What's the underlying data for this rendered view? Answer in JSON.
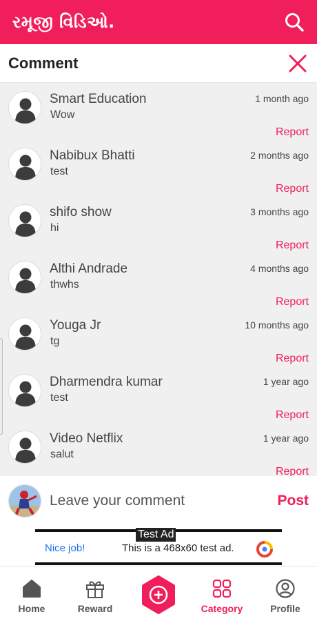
{
  "app": {
    "title": "રમૂજી વિડિઓ."
  },
  "sheet": {
    "title": "Comment"
  },
  "comments": [
    {
      "name": "Smart Education",
      "time": "1 month ago",
      "text": "Wow",
      "report": "Report"
    },
    {
      "name": "Nabibux Bhatti",
      "time": "2 months ago",
      "text": "test",
      "report": "Report"
    },
    {
      "name": "shifo show",
      "time": "3 months ago",
      "text": "hi",
      "report": "Report"
    },
    {
      "name": "Althi Andrade",
      "time": "4 months ago",
      "text": "thwhs",
      "report": "Report"
    },
    {
      "name": "Youga Jr",
      "time": "10 months ago",
      "text": "tg",
      "report": "Report"
    },
    {
      "name": "Dharmendra kumar",
      "time": "1 year ago",
      "text": "test",
      "report": "Report"
    },
    {
      "name": "Video Netflix",
      "time": "1 year ago",
      "text": "salut",
      "report": "Report"
    }
  ],
  "composer": {
    "placeholder": "Leave your comment",
    "post_label": "Post"
  },
  "ad": {
    "label": "Test Ad",
    "cta": "Nice job!",
    "text": "This is a 468x60 test ad."
  },
  "nav": {
    "home": "Home",
    "reward": "Reward",
    "category": "Category",
    "profile": "Profile",
    "active": "category"
  },
  "colors": {
    "accent": "#f01e5a",
    "background": "#f0f0f0",
    "nav_icon": "#555555"
  },
  "icons": [
    "search-icon",
    "close-icon",
    "default-avatar-icon",
    "home-icon",
    "gift-icon",
    "plus-circle-icon",
    "grid-icon",
    "profile-icon",
    "adchoices-logo"
  ]
}
